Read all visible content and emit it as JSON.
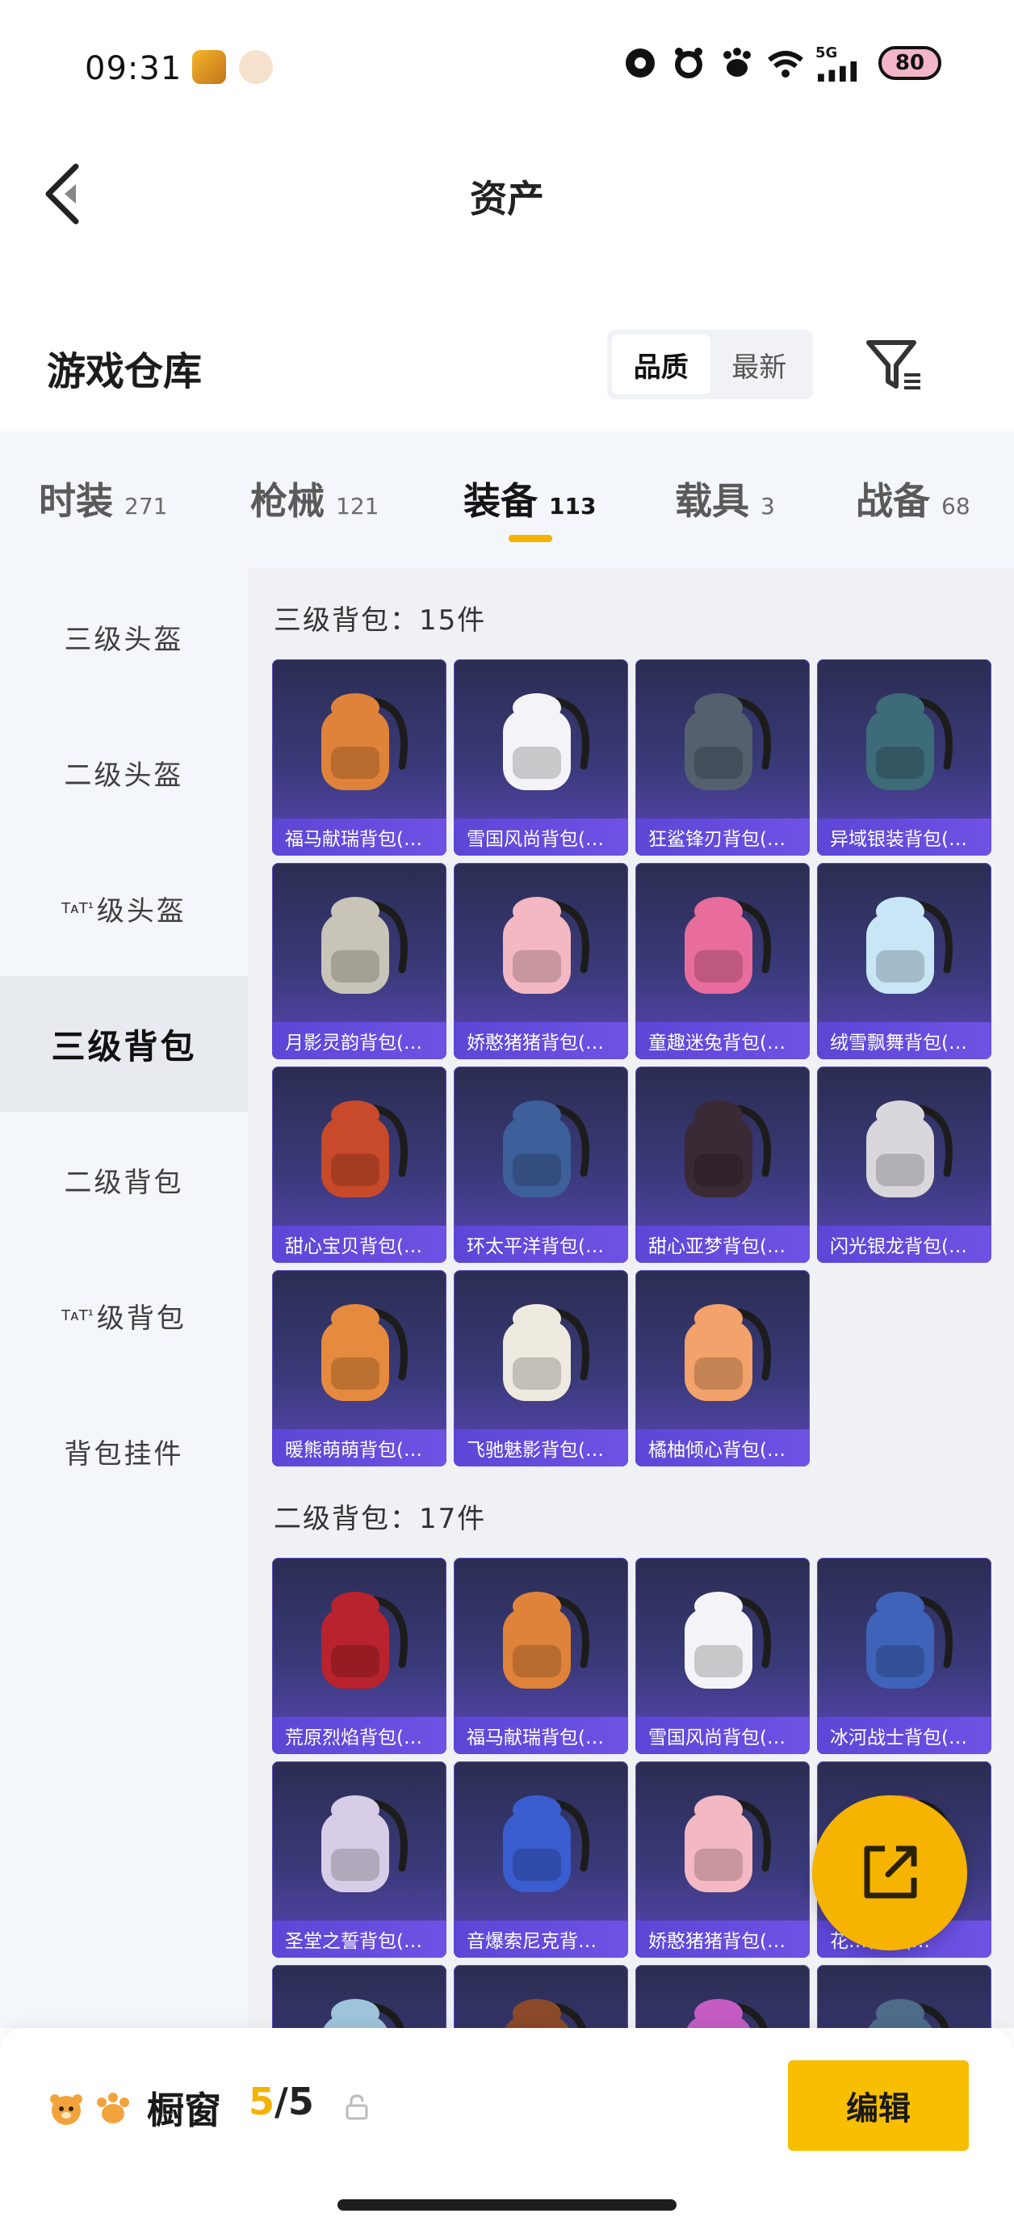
{
  "status_bar": {
    "time": "09:31",
    "network": "5G",
    "battery": "80"
  },
  "header": {
    "title": "资产"
  },
  "warehouse": {
    "title": "游戏仓库",
    "sort_options": [
      "品质",
      "最新"
    ]
  },
  "tabs": [
    {
      "label": "时装",
      "count": "271"
    },
    {
      "label": "枪械",
      "count": "121"
    },
    {
      "label": "装备",
      "count": "113"
    },
    {
      "label": "载具",
      "count": "3"
    },
    {
      "label": "战备",
      "count": "68"
    }
  ],
  "sidebar": {
    "items": [
      {
        "label": "三级头盔"
      },
      {
        "label": "二级头盔"
      },
      {
        "prefix": "TᴀT¹",
        "label": "级头盔"
      },
      {
        "label": "三级背包"
      },
      {
        "label": "二级背包"
      },
      {
        "prefix": "TᴀT¹",
        "label": "级背包"
      },
      {
        "label": "背包挂件"
      }
    ]
  },
  "sections": [
    {
      "title": "三级背包：15件",
      "items": [
        {
          "name": "福马献瑞背包(…",
          "color": "#e0833a"
        },
        {
          "name": "雪国风尚背包(…",
          "color": "#f4f4f8"
        },
        {
          "name": "狂鲨锋刃背包(…",
          "color": "#54606e"
        },
        {
          "name": "异域银装背包(…",
          "color": "#3d6b78"
        },
        {
          "name": "月影灵韵背包(…",
          "color": "#c8c4b8"
        },
        {
          "name": "娇憨猪猪背包(…",
          "color": "#f3b8c2"
        },
        {
          "name": "童趣迷兔背包(…",
          "color": "#e86c9c"
        },
        {
          "name": "绒雪飘舞背包(…",
          "color": "#c9e6f6"
        },
        {
          "name": "甜心宝贝背包(…",
          "color": "#c84a2a"
        },
        {
          "name": "环太平洋背包(…",
          "color": "#3d5f9a"
        },
        {
          "name": "甜心亚梦背包(…",
          "color": "#3a2a35"
        },
        {
          "name": "闪光银龙背包(…",
          "color": "#d9d6dc"
        },
        {
          "name": "暖熊萌萌背包(…",
          "color": "#e58a3e"
        },
        {
          "name": "飞驰魅影背包(…",
          "color": "#eeeadf"
        },
        {
          "name": "橘柚倾心背包(…",
          "color": "#f2a26a"
        }
      ]
    },
    {
      "title": "二级背包：17件",
      "items": [
        {
          "name": "荒原烈焰背包(…",
          "color": "#b8232d"
        },
        {
          "name": "福马献瑞背包(…",
          "color": "#e0833a"
        },
        {
          "name": "雪国风尚背包(…",
          "color": "#f4f4f8"
        },
        {
          "name": "冰河战士背包(…",
          "color": "#3f63b8"
        },
        {
          "name": "圣堂之誓背包(…",
          "color": "#d8cde6"
        },
        {
          "name": "音爆索尼克背…",
          "color": "#3a5dd0"
        },
        {
          "name": "娇憨猪猪背包(…",
          "color": "#f3b8c2"
        },
        {
          "name": "花…背包(…",
          "color": "#e04a6a"
        },
        {
          "name": "",
          "color": "#9ec4da"
        },
        {
          "name": "",
          "color": "#8a4a2a"
        },
        {
          "name": "",
          "color": "#c45cc4"
        },
        {
          "name": "",
          "color": "#4e6b8a"
        }
      ]
    }
  ],
  "showcase": {
    "title": "橱窗",
    "current": "5",
    "separator": "/",
    "total": "5",
    "edit_label": "编辑"
  }
}
